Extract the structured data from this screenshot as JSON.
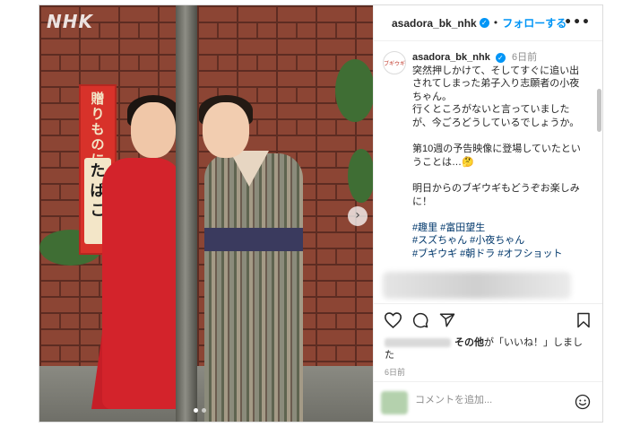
{
  "photo": {
    "watermark": "NHK",
    "sign_top": "贈りものに",
    "sign_bottom": "たばこ",
    "carousel_next": "›",
    "dots": 2
  },
  "header": {
    "username": "asadora_bk_nhk",
    "separator": "•",
    "follow_label": "フォローする",
    "more": "•••"
  },
  "caption": {
    "avatar_text": "ブギウギ",
    "username": "asadora_bk_nhk",
    "time": "6日前",
    "lines": [
      "突然押しかけて、そしてすぐに追い出",
      "されてしまった弟子入り志願者の小夜",
      "ちゃん。",
      "行くところがないと言っていました",
      "が、今ごろどうしているでしょうか。",
      "",
      "第10週の予告映像に登場していたとい",
      "うことは…🤔",
      "",
      "明日からのブギウギもどうぞお楽しみ",
      "に！",
      ""
    ],
    "hashtag_lines": [
      "#趣里 #富田望生",
      "#スズちゃん #小夜ちゃん",
      "#ブギウギ #朝ドラ #オフショット"
    ]
  },
  "engagement": {
    "likes_bold": "その他",
    "likes_text": "が「いいね！」しまし",
    "likes_text2": "た",
    "time": "6日前",
    "comment_placeholder": "コメントを追加..."
  },
  "icons": {
    "like": "heart-icon",
    "comment": "comment-icon",
    "share": "share-icon",
    "save": "bookmark-icon",
    "emoji": "emoji-icon",
    "verified": "verified-badge-icon"
  },
  "colors": {
    "accent": "#0095f6",
    "hashtag": "#00376b",
    "muted": "#8e8e8e"
  }
}
